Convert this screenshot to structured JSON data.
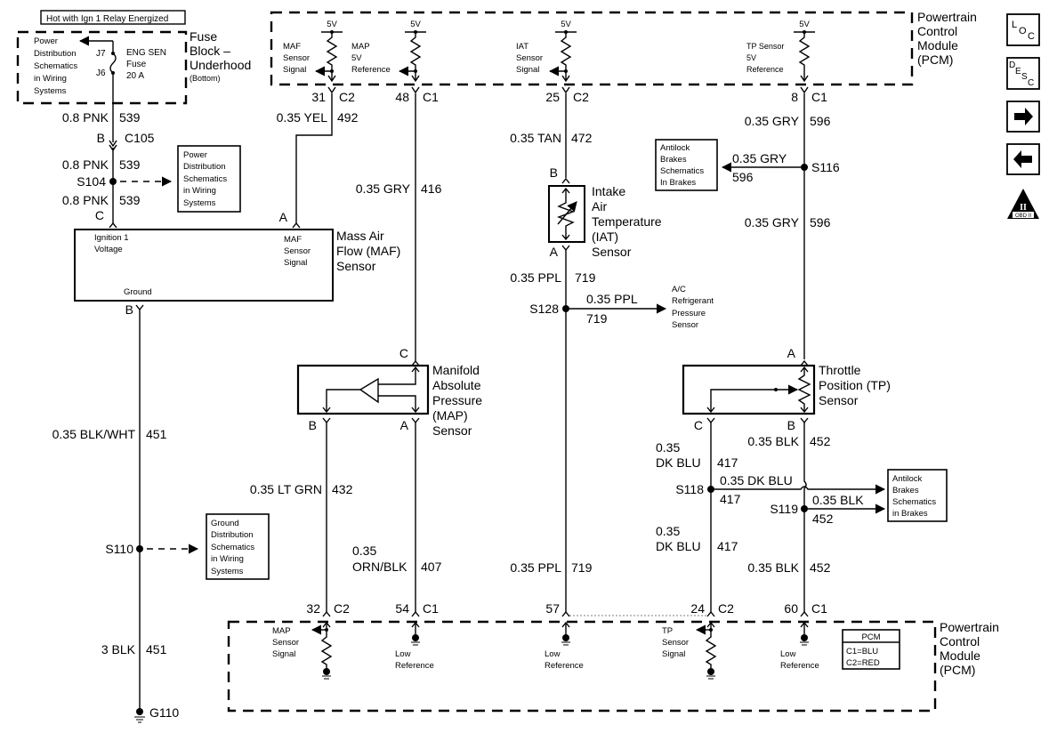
{
  "header_note": "Hot with Ign 1 Relay Energized",
  "fuse_block": {
    "title_lines": [
      "Fuse",
      "Block –",
      "Underhood"
    ],
    "subtitle": "(Bottom)",
    "ref_lines": [
      "Power",
      "Distribution",
      "Schematics",
      "in Wiring",
      "Systems"
    ],
    "j7": "J7",
    "j6": "J6",
    "fuse_lines": [
      "ENG SEN",
      "Fuse",
      "20 A"
    ]
  },
  "pcm_top": {
    "title_lines": [
      "Powertrain",
      "Control",
      "Module",
      "(PCM)"
    ],
    "voltage": "5V",
    "circuits": [
      {
        "label_lines": [
          "MAF",
          "Sensor",
          "Signal"
        ],
        "pin": "31",
        "conn": "C2"
      },
      {
        "label_lines": [
          "MAP",
          "5V",
          "Reference"
        ],
        "pin": "48",
        "conn": "C1"
      },
      {
        "label_lines": [
          "IAT",
          "Sensor",
          "Signal"
        ],
        "pin": "25",
        "conn": "C2"
      },
      {
        "label_lines": [
          "TP Sensor",
          "5V",
          "Reference"
        ],
        "pin": "8",
        "conn": "C1"
      }
    ]
  },
  "pcm_bottom": {
    "title_lines": [
      "Powertrain",
      "Control",
      "Module",
      "(PCM)"
    ],
    "circuits": [
      {
        "label_lines": [
          "MAP",
          "Sensor",
          "Signal"
        ],
        "pin": "32",
        "conn": "C2"
      },
      {
        "label_lines": [
          "Low",
          "Reference"
        ],
        "pin": "54",
        "conn": "C1"
      },
      {
        "label_lines": [
          "Low",
          "Reference"
        ],
        "pin": "57",
        "conn": ""
      },
      {
        "label_lines": [
          "TP",
          "Sensor",
          "Signal"
        ],
        "pin": "24",
        "conn": "C2"
      },
      {
        "label_lines": [
          "Low",
          "Reference"
        ],
        "pin": "60",
        "conn": "C1"
      }
    ],
    "legend": {
      "title": "PCM",
      "lines": [
        "C1=BLU",
        "C2=RED"
      ]
    }
  },
  "left_circuit": {
    "wire1": {
      "gauge": "0.8 PNK",
      "num": "539"
    },
    "connector_pin": "B",
    "connector": "C105",
    "wire2": {
      "gauge": "0.8 PNK",
      "num": "539"
    },
    "splice": "S104",
    "wire3": {
      "gauge": "0.8 PNK",
      "num": "539"
    },
    "pin_c": "C",
    "ref_lines": [
      "Power",
      "Distribution",
      "Schematics",
      "in Wiring",
      "Systems"
    ],
    "ground_pin": "B",
    "wire4": {
      "gauge": "0.35 BLK/WHT",
      "num": "451"
    },
    "splice2": "S110",
    "ground_ref_lines": [
      "Ground",
      "Distribution",
      "Schematics",
      "in Wiring",
      "Systems"
    ],
    "wire5": {
      "gauge": "3 BLK",
      "num": "451"
    },
    "ground": "G110"
  },
  "maf": {
    "title_lines": [
      "Mass Air",
      "Flow (MAF)",
      "Sensor"
    ],
    "ign_label_lines": [
      "Ignition 1",
      "Voltage"
    ],
    "ground_label": "Ground",
    "signal_label_lines": [
      "MAF",
      "Sensor",
      "Signal"
    ],
    "pin_a": "A",
    "wire": {
      "gauge": "0.35 YEL",
      "num": "492"
    }
  },
  "map": {
    "title_lines": [
      "Manifold",
      "Absolute",
      "Pressure",
      "(MAP)",
      "Sensor"
    ],
    "pin_c": "C",
    "pin_b": "B",
    "pin_a": "A",
    "wire_ref": {
      "gauge": "0.35 GRY",
      "num": "416"
    },
    "wire_sig": {
      "gauge": "0.35 LT GRN",
      "num": "432"
    },
    "wire_low": {
      "gauge_lines": [
        "0.35",
        "ORN/BLK"
      ],
      "num": "407"
    }
  },
  "iat": {
    "title_lines": [
      "Intake",
      "Air",
      "Temperature",
      "(IAT)",
      "Sensor"
    ],
    "pin_b": "B",
    "pin_a": "A",
    "wire_sig": {
      "gauge": "0.35 TAN",
      "num": "472"
    },
    "wire_low1": {
      "gauge": "0.35 PPL",
      "num": "719"
    },
    "splice": "S128",
    "branch": {
      "gauge": "0.35 PPL",
      "num": "719"
    },
    "branch_dest_lines": [
      "A/C",
      "Refrigerant",
      "Pressure",
      "Sensor"
    ],
    "wire_low2": {
      "gauge": "0.35 PPL",
      "num": "719"
    }
  },
  "tp": {
    "title_lines": [
      "Throttle",
      "Position (TP)",
      "Sensor"
    ],
    "pin_a": "A",
    "pin_b": "B",
    "pin_c": "C",
    "wire_ref1": {
      "gauge": "0.35 GRY",
      "num": "596"
    },
    "splice_ref": "S116",
    "abs_branch": {
      "gauge": "0.35 GRY",
      "num": "596"
    },
    "abs_ref_lines": [
      "Antilock",
      "Brakes",
      "Schematics",
      "In Brakes"
    ],
    "wire_ref2": {
      "gauge": "0.35 GRY",
      "num": "596"
    },
    "wire_sig1": {
      "gauge_lines": [
        "0.35",
        "DK BLU"
      ],
      "num": "417"
    },
    "splice_sig": "S118",
    "sig_branch": {
      "gauge": "0.35 DK BLU",
      "num": "417"
    },
    "wire_sig2": {
      "gauge_lines": [
        "0.35",
        "DK BLU"
      ],
      "num": "417"
    },
    "wire_low1": {
      "gauge": "0.35 BLK",
      "num": "452"
    },
    "splice_low": "S119",
    "low_branch": {
      "gauge": "0.35 BLK",
      "num": "452"
    },
    "abs_ref2_lines": [
      "Antilock",
      "Brakes",
      "Schematics",
      "in Brakes"
    ],
    "wire_low2": {
      "gauge": "0.35 BLK",
      "num": "452"
    }
  },
  "nav_icons": [
    {
      "name": "loc-icon",
      "main": "L",
      "subs": [
        "O",
        "C"
      ]
    },
    {
      "name": "desc-icon",
      "main": "D",
      "subs": [
        "E",
        "S",
        "C"
      ]
    },
    {
      "name": "next-arrow-icon"
    },
    {
      "name": "prev-arrow-icon"
    },
    {
      "name": "obd2-icon",
      "roman": "II",
      "label": "OBD II"
    }
  ]
}
